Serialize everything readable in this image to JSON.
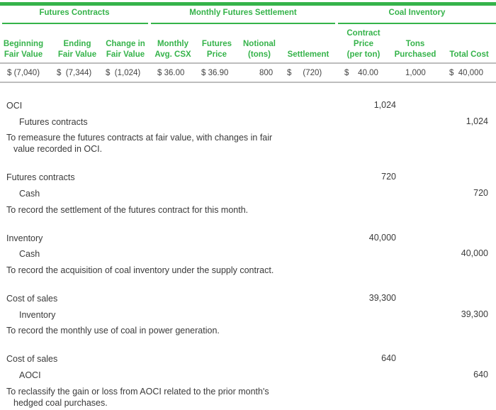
{
  "table": {
    "groups": [
      {
        "label": "Futures Contracts"
      },
      {
        "label": "Monthly Futures Settlement"
      },
      {
        "label": "Coal Inventory"
      }
    ],
    "columns": [
      {
        "lines": [
          "",
          "Beginning",
          "Fair Value"
        ]
      },
      {
        "lines": [
          "",
          "Ending",
          "Fair Value"
        ]
      },
      {
        "lines": [
          "",
          "Change in",
          "Fair Value"
        ]
      },
      {
        "lines": [
          "",
          "Monthly",
          "Avg. CSX"
        ]
      },
      {
        "lines": [
          "",
          "Futures",
          "Price"
        ]
      },
      {
        "lines": [
          "",
          "Notional",
          "(tons)"
        ]
      },
      {
        "lines": [
          "",
          "",
          "Settlement"
        ]
      },
      {
        "lines": [
          "Contract",
          "Price",
          "(per ton)"
        ]
      },
      {
        "lines": [
          "",
          "Tons",
          "Purchased"
        ]
      },
      {
        "lines": [
          "",
          "",
          "Total Cost"
        ]
      }
    ],
    "row": [
      "$ (7,040)",
      "$  (7,344)",
      "$  (1,024)",
      "$ 36.00",
      "$ 36.90",
      "800",
      "$     (720)",
      "$    40.00",
      "1,000",
      "$  40,000"
    ]
  },
  "entries": [
    {
      "debit_account": "OCI",
      "debit_amount": "1,024",
      "credit_account": "Futures contracts",
      "credit_amount": "1,024",
      "memo_lines": [
        "To remeasure the futures contracts at fair value, with changes in fair",
        "value recorded in OCI."
      ]
    },
    {
      "debit_account": "Futures contracts",
      "debit_amount": "720",
      "credit_account": "Cash",
      "credit_amount": "720",
      "memo_lines": [
        "To record the settlement of the futures contract for this month."
      ]
    },
    {
      "debit_account": "Inventory",
      "debit_amount": "40,000",
      "credit_account": "Cash",
      "credit_amount": "40,000",
      "memo_lines": [
        "To record the acquisition of coal inventory under the supply contract."
      ]
    },
    {
      "debit_account": "Cost of sales",
      "debit_amount": "39,300",
      "credit_account": "Inventory",
      "credit_amount": "39,300",
      "memo_lines": [
        "To record the monthly use of coal in power generation."
      ]
    },
    {
      "debit_account": "Cost of sales",
      "debit_amount": "640",
      "credit_account": "AOCI",
      "credit_amount": "640",
      "memo_lines": [
        "To reclassify the gain or loss from AOCI related to the prior month's",
        "hedged coal purchases."
      ]
    }
  ],
  "colors": {
    "accent": "#35b34a",
    "rule": "#bdbdbd"
  }
}
